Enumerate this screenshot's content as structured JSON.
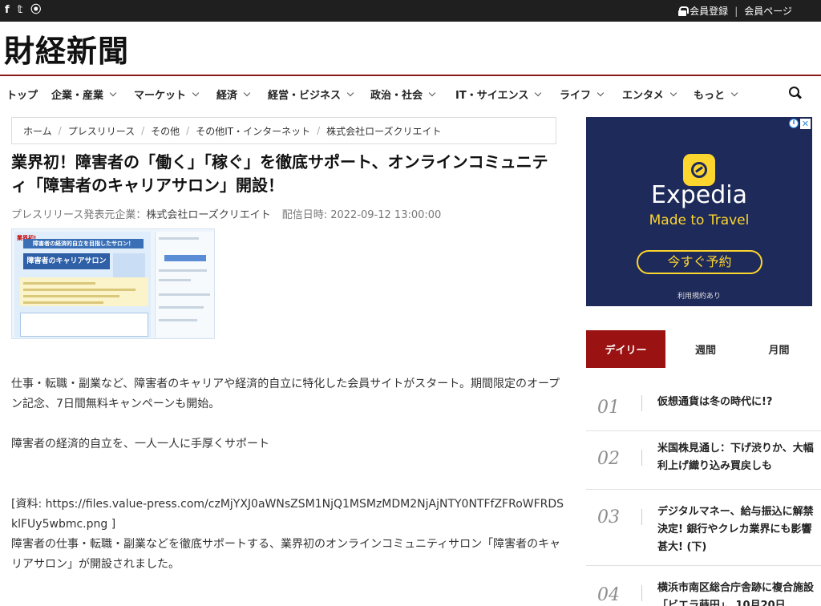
{
  "topbar": {
    "social_icons": [
      "facebook-icon",
      "twitter-icon",
      "rss-icon"
    ],
    "social_glyphs": [
      "f",
      "𝕥",
      "⦿"
    ],
    "member_register": "会員登録",
    "member_page": "会員ページ",
    "separator": "|"
  },
  "logo": {
    "text": "財経新聞"
  },
  "nav": {
    "items": [
      {
        "label": "トップ",
        "dropdown": false
      },
      {
        "label": "企業・産業",
        "dropdown": true
      },
      {
        "label": "マーケット",
        "dropdown": true
      },
      {
        "label": "経済",
        "dropdown": true
      },
      {
        "label": "経営・ビジネス",
        "dropdown": true
      },
      {
        "label": "政治・社会",
        "dropdown": true
      },
      {
        "label": "IT・サイエンス",
        "dropdown": true
      },
      {
        "label": "ライフ",
        "dropdown": true
      },
      {
        "label": "エンタメ",
        "dropdown": true
      },
      {
        "label": "もっと",
        "dropdown": true
      }
    ]
  },
  "breadcrumb": [
    "ホーム",
    "プレスリリース",
    "その他",
    "その他IT・インターネット",
    "株式会社ローズクリエイト"
  ],
  "article": {
    "title": "業界初！障害者の「働く」「稼ぐ」を徹底サポート、オンラインコミュニティ「障害者のキャリアサロン」開設！",
    "meta_prefix": "プレスリリース発表元企業：",
    "company": "株式会社ローズクリエイト",
    "date_label": "配信日時: ",
    "date": "2022-09-12 13:00:00",
    "paragraphs": [
      "仕事・転職・副業など、障害者のキャリアや経済的自立に特化した会員サイトがスタート。期間限定のオープン記念、7日間無料キャンペーンも開始。",
      "",
      "障害者の経済的自立を、一人一人に手厚くサポート",
      "",
      "",
      "[資料: https://files.value-press.com/czMjYXJ0aWNsZSM1NjQ1MSMzMDM2NjAjNTY0NTFfZFRoWFRDSklFUy5wbmc.png ]",
      "障害者の仕事・転職・副業などを徹底サポートする、業界初のオンラインコミュニティサロン「障害者のキャリアサロン」が開設されました。"
    ]
  },
  "thumbnail": {
    "badge": "業界初!",
    "head": "障害者の経済的自立を目指したサロン！",
    "logo": "障害者のキャリアサロン"
  },
  "ad": {
    "brand": "Expedia",
    "tagline": "Made to Travel",
    "button": "今すぐ予約",
    "note": "利用規約あり",
    "info": "i",
    "close": "✕"
  },
  "ranking": {
    "tabs": [
      "デイリー",
      "週間",
      "月間"
    ],
    "active_tab": "デイリー",
    "items": [
      {
        "num": "01",
        "text": "仮想通貨は冬の時代に!?"
      },
      {
        "num": "02",
        "text": "米国株見通し：下げ渋りか、大幅利上げ織り込み買戻しも"
      },
      {
        "num": "03",
        "text": "デジタルマネー、給与振込に解禁決定! 銀行やクレカ業界にも影響甚大! (下)"
      },
      {
        "num": "04",
        "text": "横浜市南区総合庁舎跡に複合施設「ビエラ蒔田」、10月20日"
      }
    ]
  }
}
